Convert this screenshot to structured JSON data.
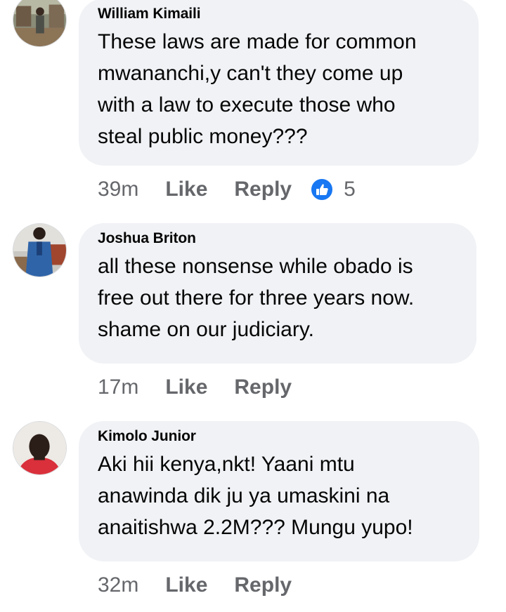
{
  "comments": [
    {
      "author": "William Kimaili",
      "lines": [
        "These laws are made for common",
        "mwananchi,y can't they come up",
        "with a law to execute those who",
        "steal public money???"
      ],
      "time": "39m",
      "like_label": "Like",
      "reply_label": "Reply",
      "reaction_icon": "thumbs-up-icon",
      "reaction_count": "5"
    },
    {
      "author": "Joshua Briton",
      "lines": [
        "all these nonsense while obado is",
        "free out there for three years now.",
        "shame on our judiciary."
      ],
      "time": "17m",
      "like_label": "Like",
      "reply_label": "Reply"
    },
    {
      "author": "Kimolo Junior",
      "lines": [
        "Aki hii kenya,nkt! Yaani mtu",
        "anawinda dik ju ya umaskini na",
        "anaitishwa 2.2M??? Mungu yupo!"
      ],
      "time": "32m",
      "like_label": "Like",
      "reply_label": "Reply"
    }
  ],
  "colors": {
    "bubble": "#f0f2f5",
    "text": "#050505",
    "meta": "#65676b",
    "like_blue": "#1877f2"
  }
}
